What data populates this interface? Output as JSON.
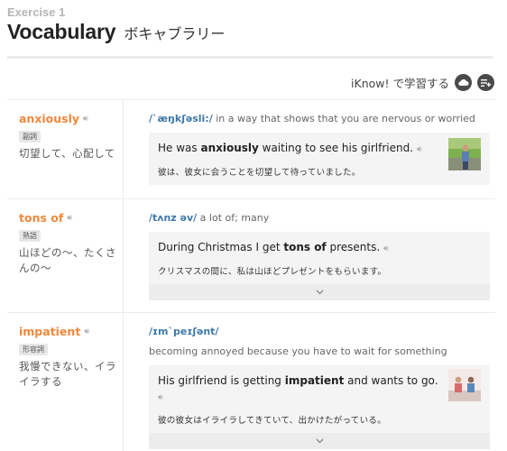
{
  "header": {
    "exercise": "Exercise 1",
    "title": "Vocabulary",
    "title_ja": "ボキャブラリー"
  },
  "iknow": {
    "label": "iKnow! で学習する",
    "icons": [
      "cloud-icon",
      "add-list-icon"
    ]
  },
  "entries": [
    {
      "word": "anxiously",
      "pos": "副詞",
      "gloss": "切望して、心配して",
      "phonetic": "/ˋæŋkʃəsli:/",
      "definition": "in a way that shows that you are nervous or worried",
      "example_pre": "He was ",
      "example_bold": "anxiously",
      "example_post": " waiting to see his girlfriend.",
      "example_ja": "彼は、彼女に会うことを切望して待っていました。"
    },
    {
      "word": "tons of",
      "pos": "熟語",
      "gloss": "山ほどの～、たくさんの～",
      "phonetic": "/tʌnz əv/",
      "definition": "a lot of; many",
      "example_pre": "During Christmas I get ",
      "example_bold": "tons of",
      "example_post": " presents.",
      "example_ja": "クリスマスの間に、私は山ほどプレゼントをもらいます。"
    },
    {
      "word": "impatient",
      "pos": "形容詞",
      "gloss": "我慢できない、イライラする",
      "phonetic": "/ɪmˋpeɪʃənt/",
      "definition": "becoming annoyed because you have to wait for something",
      "example_pre": "His girlfriend is getting ",
      "example_bold": "impatient",
      "example_post": " and wants to go.",
      "example_ja": "彼の彼女はイライラしてきていて、出かけたがっている。"
    }
  ],
  "colors": {
    "word": "#f0883c",
    "phonetic": "#3e78a8",
    "example_bg": "#f4f4f4"
  }
}
